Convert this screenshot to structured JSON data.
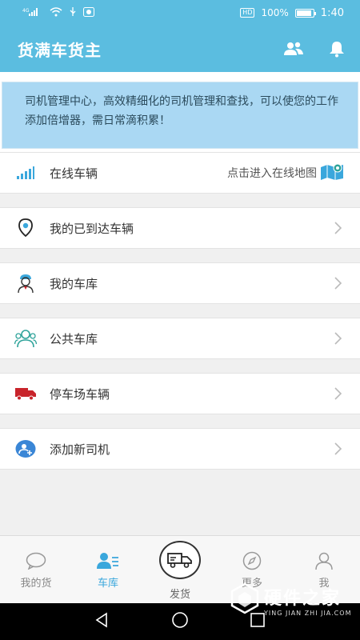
{
  "status_bar": {
    "signal": "⁴ᴳ",
    "hd": "HD",
    "battery_percent": "100%",
    "time": "1:40"
  },
  "header": {
    "title": "货满车货主",
    "icons": [
      "contacts-icon",
      "bell-icon"
    ]
  },
  "banner": {
    "text": "司机管理中心，高效精细化的司机管理和查找，可以使您的工作添加倍增器，需日常滴积累！"
  },
  "list": {
    "items": [
      {
        "label": "在线车辆",
        "hint": "点击进入在线地图",
        "icon": "signal-bars-icon"
      },
      {
        "label": "我的已到达车辆",
        "icon": "location-pin-icon"
      },
      {
        "label": "我的车库",
        "icon": "driver-avatar-icon"
      },
      {
        "label": "公共车库",
        "icon": "group-icon"
      },
      {
        "label": "停车场车辆",
        "icon": "truck-icon"
      },
      {
        "label": "添加新司机",
        "icon": "add-user-icon"
      }
    ]
  },
  "bottom_nav": {
    "items": [
      {
        "label": "我的货",
        "icon": "chat-bubble-icon"
      },
      {
        "label": "车库",
        "icon": "user-list-icon",
        "active": true
      },
      {
        "label": "发货",
        "icon": "delivery-truck-icon"
      },
      {
        "label": "更多",
        "icon": "compass-icon"
      },
      {
        "label": "我",
        "icon": "person-icon"
      }
    ]
  },
  "watermark": {
    "main": "硬件之家",
    "sub": "YING JIAN ZHI JIA.COM"
  },
  "colors": {
    "primary": "#5bbde0",
    "banner_bg": "#aad8f3",
    "active_nav": "#3aa7dc",
    "truck_red": "#c8242b",
    "teal": "#2ea39a"
  }
}
